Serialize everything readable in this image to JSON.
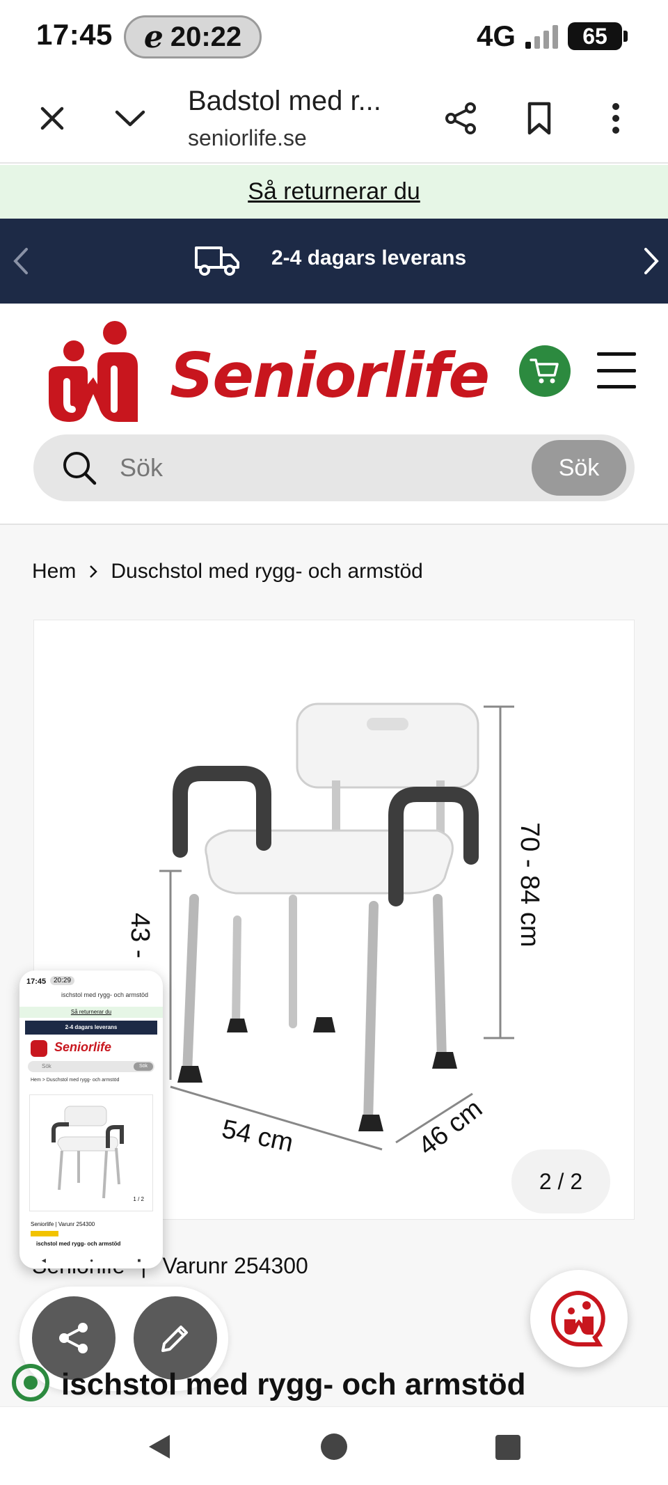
{
  "status_bar": {
    "time": "17:45",
    "pill_time": "20:22",
    "network": "4G",
    "battery": "65"
  },
  "browser": {
    "title": "Badstol med r...",
    "url": "seniorlife.se"
  },
  "return_banner": {
    "text": "Så returnerar du"
  },
  "announcement": {
    "text": "2-4 dagars leverans"
  },
  "header": {
    "brand": "Seniorlife",
    "search_placeholder": "Sök",
    "search_button": "Sök"
  },
  "breadcrumb": {
    "home": "Hem",
    "current": "Duschstol med rygg- och armstöd"
  },
  "product": {
    "dimensions": {
      "height_total": "70 - 84 cm",
      "seat_height": "43 -",
      "width": "54 cm",
      "depth": "46 cm"
    },
    "pager": "2 / 2",
    "brand_name": "Seniorlife",
    "separator": "|",
    "article": "Varunr 254300",
    "title": "ischstol med rygg- och armstöd"
  },
  "thumbnail": {
    "time": "17:45",
    "pill": "20:29",
    "title": "ischstol med rygg- och armstöd",
    "return": "Så returnerar du",
    "announce": "2-4 dagars leverans",
    "brand": "Seniorlife",
    "search": "Sök",
    "search_btn": "Sök",
    "breadcrumb": "Hem > Duschstol med rygg- och armstöd",
    "pager": "1 / 2",
    "brand_line": "Seniorlife | Varunr 254300"
  },
  "colors": {
    "brand_red": "#c8161e",
    "navy": "#1d2a46",
    "green": "#2c8a3f",
    "banner_green": "#e6f6e6"
  }
}
